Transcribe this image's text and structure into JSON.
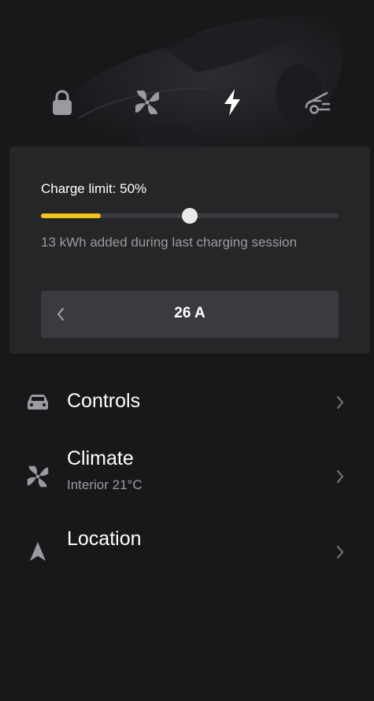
{
  "header": {
    "icons": [
      {
        "name": "lock-icon"
      },
      {
        "name": "fan-icon"
      },
      {
        "name": "charging-bolt-icon"
      },
      {
        "name": "frunk-icon"
      }
    ],
    "active_icon": "charging-bolt-icon"
  },
  "charging": {
    "title": "Charge limit: 50%",
    "limit_percent": 50,
    "current_level_percent": 20,
    "note": "13 kWh added during last charging session",
    "amps": "26 A",
    "accent_color": "#f2c31b"
  },
  "menu": {
    "controls": {
      "label": "Controls",
      "icon": "car-icon"
    },
    "climate": {
      "label": "Climate",
      "subtitle": "Interior 21°C",
      "icon": "fan-icon"
    },
    "location": {
      "label": "Location",
      "icon": "location-arrow-icon"
    }
  }
}
